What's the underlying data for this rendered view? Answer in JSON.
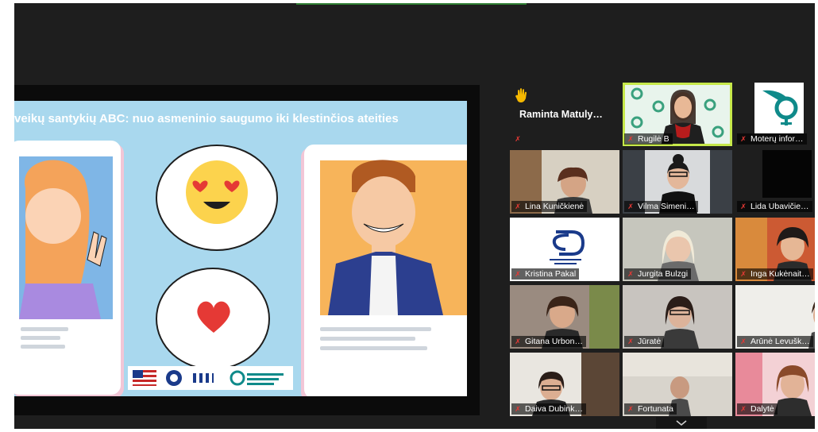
{
  "slide": {
    "title": "veikų santykių ABC: nuo asmeninio saugumo iki klestinčios ateities"
  },
  "participants": [
    {
      "name": "Raminta  Matuly…",
      "hand_raised": true
    },
    {
      "name": "Rugilė B",
      "active_speaker": true
    },
    {
      "name": "Moterų infor…"
    },
    {
      "name": "Lina Kuničkienė"
    },
    {
      "name": "Vilma Simeni…"
    },
    {
      "name": "Lida Ubavičie…"
    },
    {
      "name": "Kristina Pakal"
    },
    {
      "name": "Jurgita Bulzgi"
    },
    {
      "name": "Inga Kukėnait…"
    },
    {
      "name": "Gitana Urbon…"
    },
    {
      "name": "Jūratė"
    },
    {
      "name": "Arūnė Levušk…"
    },
    {
      "name": "Daiva Dubink…"
    },
    {
      "name": "Fortunata"
    },
    {
      "name": "Dalytė"
    }
  ],
  "icons": {
    "mic_muted": "mic-muted-icon",
    "raised_hand": "raised-hand-icon",
    "scroll_down": "chevron-down-icon"
  },
  "colors": {
    "active_speaker_border": "#c6e84a",
    "mic_muted": "#e53935",
    "slide_background": "#a9d8ee"
  }
}
